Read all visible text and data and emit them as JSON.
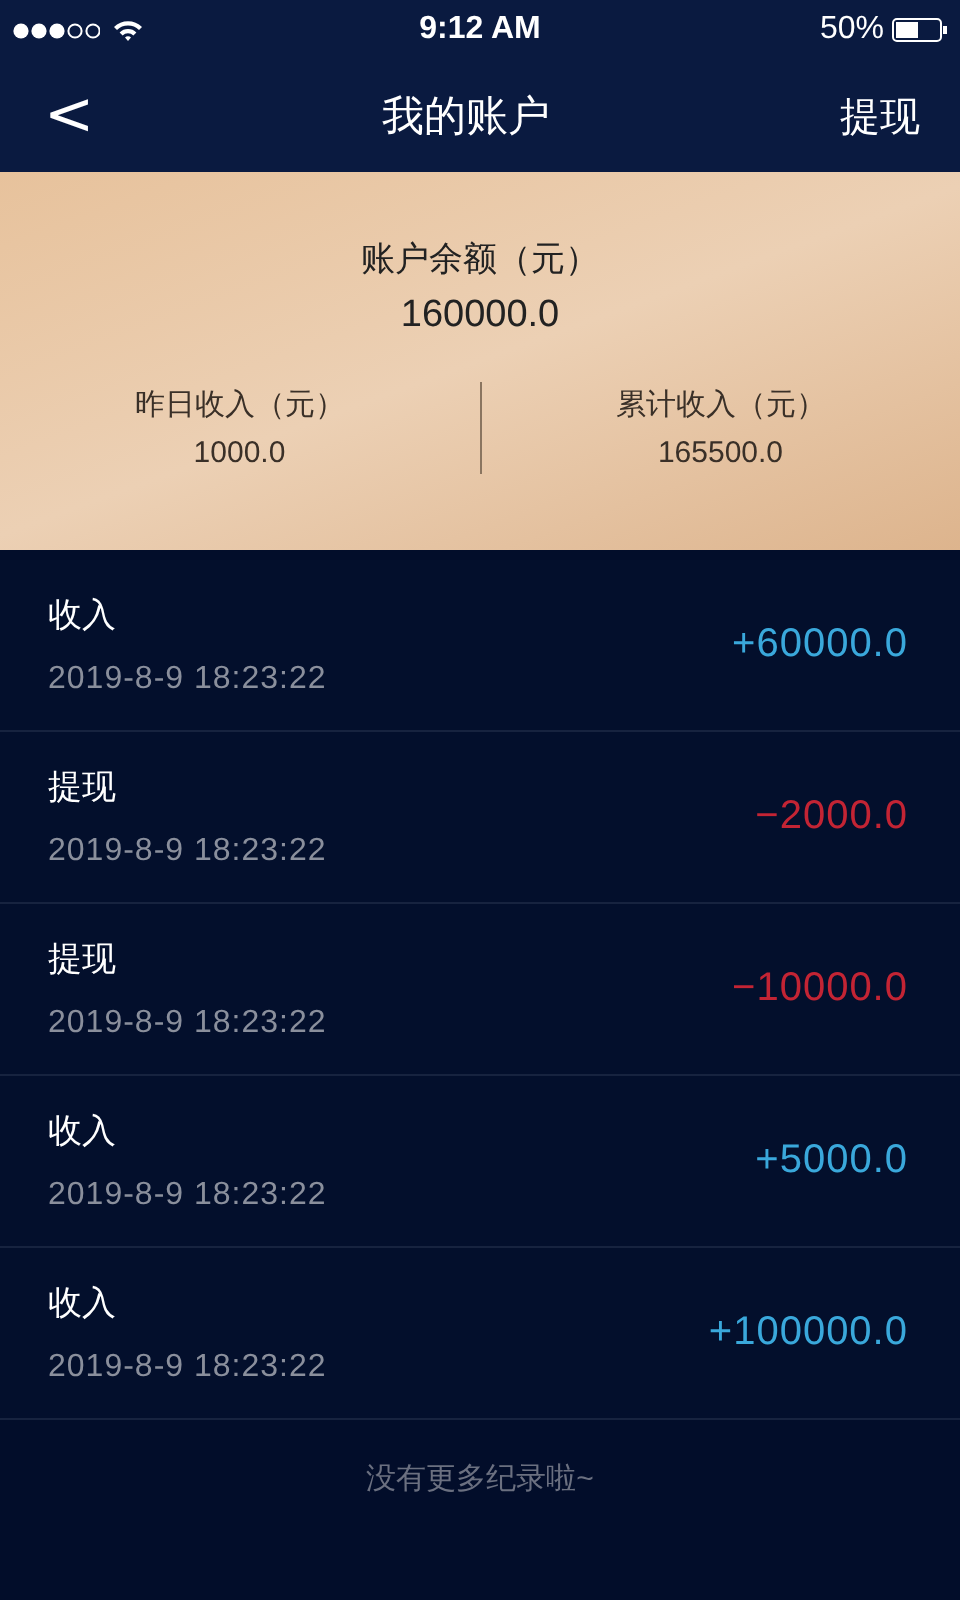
{
  "status_bar": {
    "time": "9:12 AM",
    "battery": "50%"
  },
  "nav": {
    "back": "<",
    "title": "我的账户",
    "action": "提现"
  },
  "summary": {
    "balance_label": "账户余额（元）",
    "balance": "160000.0",
    "stats": [
      {
        "label": "昨日收入（元）",
        "value": "1000.0"
      },
      {
        "label": "累计收入（元）",
        "value": "165500.0"
      }
    ]
  },
  "records": [
    {
      "kind": "income",
      "title": "收入",
      "time": "2019-8-9 18:23:22",
      "amount": "+60000.0"
    },
    {
      "kind": "withdrawal",
      "title": "提现",
      "time": "2019-8-9 18:23:22",
      "amount": "−2000.0"
    },
    {
      "kind": "withdrawal",
      "title": "提现",
      "time": "2019-8-9 18:23:22",
      "amount": "−10000.0"
    },
    {
      "kind": "income",
      "title": "收入",
      "time": "2019-8-9 18:23:22",
      "amount": "+5000.0"
    },
    {
      "kind": "income",
      "title": "收入",
      "time": "2019-8-9 18:23:22",
      "amount": "+100000.0"
    }
  ],
  "footer": "没有更多纪录啦~"
}
